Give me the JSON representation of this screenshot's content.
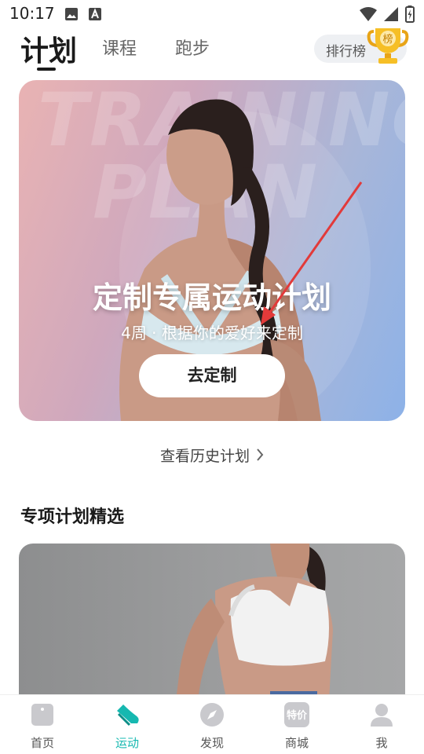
{
  "status_bar": {
    "time": "10:17"
  },
  "tabs": [
    {
      "label": "计划",
      "active": true
    },
    {
      "label": "课程",
      "active": false
    },
    {
      "label": "跑步",
      "active": false
    }
  ],
  "leaderboard": {
    "label": "排行榜",
    "badge": "榜"
  },
  "hero": {
    "bg_text_line1": "TRAINING",
    "bg_text_line2": "PLAN",
    "title": "定制专属运动计划",
    "subtitle": "4周 · 根据你的爱好来定制",
    "button_label": "去定制"
  },
  "history_link": {
    "label": "查看历史计划"
  },
  "section": {
    "title": "专项计划精选"
  },
  "bottom_nav": [
    {
      "label": "首页",
      "icon": "home-icon",
      "active": false
    },
    {
      "label": "运动",
      "icon": "shoe-icon",
      "active": true
    },
    {
      "label": "发现",
      "icon": "compass-icon",
      "active": false
    },
    {
      "label": "商城",
      "icon": "special-price-icon",
      "badge": "特价",
      "active": false
    },
    {
      "label": "我",
      "icon": "profile-icon",
      "active": false
    }
  ],
  "colors": {
    "accent": "#16b8b0",
    "arrow": "#e23a3a"
  }
}
